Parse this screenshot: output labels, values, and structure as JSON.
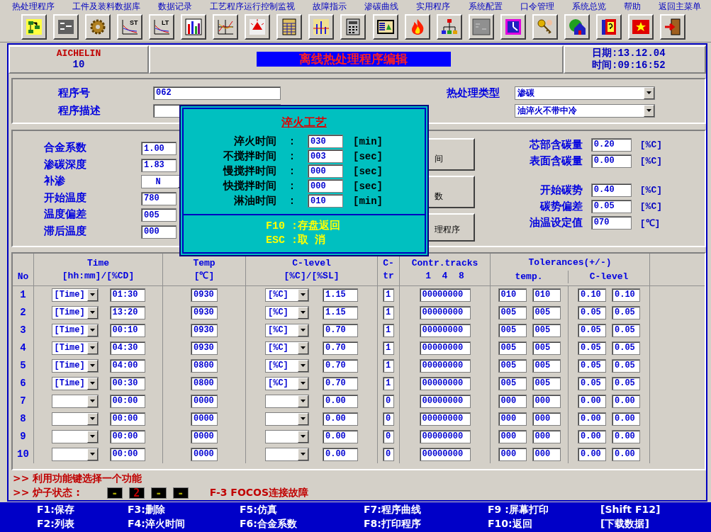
{
  "menu": [
    "热处理程序",
    "工件及装料数据库",
    "数据记录",
    "工艺程序运行控制监视",
    "故障指示",
    "渗碳曲线",
    "实用程序",
    "系统配置",
    "口令管理",
    "系统总览",
    "帮助",
    "返回主菜单"
  ],
  "toolbar": [
    {
      "kind": "flowchart"
    },
    {
      "kind": "list"
    },
    {
      "kind": "gear"
    },
    {
      "kind": "trend",
      "text": "ST"
    },
    {
      "kind": "trend",
      "text": "LT"
    },
    {
      "kind": "bars"
    },
    {
      "kind": "lines"
    },
    {
      "kind": "alarm"
    },
    {
      "kind": "grid"
    },
    {
      "kind": "gauge"
    },
    {
      "kind": "calculator"
    },
    {
      "kind": "monitor"
    },
    {
      "kind": "fire"
    },
    {
      "kind": "network"
    },
    {
      "kind": "panel"
    },
    {
      "kind": "clock"
    },
    {
      "kind": "keys"
    },
    {
      "kind": "house"
    },
    {
      "kind": "help"
    },
    {
      "kind": "flag"
    },
    {
      "kind": "exit"
    }
  ],
  "header": {
    "brand": "AICHELIN",
    "unit": "10",
    "title": "离线热处理程序编辑",
    "date": "日期:13.12.04",
    "time": "时间:09:16:52"
  },
  "program": {
    "number_label": "程序号",
    "number": "062",
    "desc_label": "程序描述",
    "type_label": "热处理类型",
    "type": "渗碳",
    "subtype": "油淬火不带中冷"
  },
  "params_left": [
    {
      "kind": "field",
      "label": "合金系数",
      "value": "1.00"
    },
    {
      "kind": "field",
      "label": "渗碳深度",
      "value": "1.83"
    },
    {
      "kind": "dropdown",
      "label": "补渗",
      "value": "N"
    },
    {
      "kind": "field",
      "label": "开始温度",
      "value": "780"
    },
    {
      "kind": "field",
      "label": "温度偏差",
      "value": "005"
    },
    {
      "kind": "field",
      "label": "滞后温度",
      "value": "000"
    }
  ],
  "side_buttons": [
    "间",
    "数",
    "理程序"
  ],
  "carbon": [
    {
      "label": "芯部含碳量",
      "value": "0.20",
      "unit": "[%C]"
    },
    {
      "label": "表面含碳量",
      "value": "0.00",
      "unit": "[%C]"
    }
  ],
  "atmosphere": [
    {
      "label": "开始碳势",
      "value": "0.40",
      "unit": "[%C]"
    },
    {
      "label": "碳势偏差",
      "value": "0.05",
      "unit": "[%C]"
    },
    {
      "label": "油温设定值",
      "value": "070",
      "unit": "[℃]"
    }
  ],
  "table": {
    "columns": {
      "no": "No",
      "time": [
        "Time",
        "[hh:mm]/[%CD]"
      ],
      "temp": [
        "Temp",
        "[℃]"
      ],
      "c_level": [
        "C-level",
        "[%C]/[%SL]"
      ],
      "ctr": [
        "C-",
        "tr"
      ],
      "tracks": [
        "Contr.tracks",
        "1  4  8"
      ],
      "tolerances": "Tolerances(+/-)",
      "tol_temp": "temp.",
      "tol_c": "C-level"
    },
    "rows": [
      {
        "no": "1",
        "mode": "[Time]",
        "time": "01:30",
        "temp": "0930",
        "c_mode": "[%C]",
        "c_level": "1.15",
        "ctr": "1",
        "tracks": "00000000",
        "tol_temp": [
          "010",
          "010"
        ],
        "tol_c": [
          "0.10",
          "0.10"
        ]
      },
      {
        "no": "2",
        "mode": "[Time]",
        "time": "13:20",
        "temp": "0930",
        "c_mode": "[%C]",
        "c_level": "1.15",
        "ctr": "1",
        "tracks": "00000000",
        "tol_temp": [
          "005",
          "005"
        ],
        "tol_c": [
          "0.05",
          "0.05"
        ]
      },
      {
        "no": "3",
        "mode": "[Time]",
        "time": "00:10",
        "temp": "0930",
        "c_mode": "[%C]",
        "c_level": "0.70",
        "ctr": "1",
        "tracks": "00000000",
        "tol_temp": [
          "005",
          "005"
        ],
        "tol_c": [
          "0.05",
          "0.05"
        ]
      },
      {
        "no": "4",
        "mode": "[Time]",
        "time": "04:30",
        "temp": "0930",
        "c_mode": "[%C]",
        "c_level": "0.70",
        "ctr": "1",
        "tracks": "00000000",
        "tol_temp": [
          "005",
          "005"
        ],
        "tol_c": [
          "0.05",
          "0.05"
        ]
      },
      {
        "no": "5",
        "mode": "[Time]",
        "time": "04:00",
        "temp": "0800",
        "c_mode": "[%C]",
        "c_level": "0.70",
        "ctr": "1",
        "tracks": "00000000",
        "tol_temp": [
          "005",
          "005"
        ],
        "tol_c": [
          "0.05",
          "0.05"
        ]
      },
      {
        "no": "6",
        "mode": "[Time]",
        "time": "00:30",
        "temp": "0800",
        "c_mode": "[%C]",
        "c_level": "0.70",
        "ctr": "1",
        "tracks": "00000000",
        "tol_temp": [
          "005",
          "005"
        ],
        "tol_c": [
          "0.05",
          "0.05"
        ]
      },
      {
        "no": "7",
        "time": "00:00",
        "temp": "0000",
        "c_level": "0.00",
        "ctr": "0",
        "tracks": "00000000",
        "tol_temp": [
          "000",
          "000"
        ],
        "tol_c": [
          "0.00",
          "0.00"
        ]
      },
      {
        "no": "8",
        "time": "00:00",
        "temp": "0000",
        "c_level": "0.00",
        "ctr": "0",
        "tracks": "00000000",
        "tol_temp": [
          "000",
          "000"
        ],
        "tol_c": [
          "0.00",
          "0.00"
        ]
      },
      {
        "no": "9",
        "time": "00:00",
        "temp": "0000",
        "c_level": "0.00",
        "ctr": "0",
        "tracks": "00000000",
        "tol_temp": [
          "000",
          "000"
        ],
        "tol_c": [
          "0.00",
          "0.00"
        ]
      },
      {
        "no": "10",
        "time": "00:00",
        "temp": "0000",
        "c_level": "0.00",
        "ctr": "0",
        "tracks": "00000000",
        "tol_temp": [
          "000",
          "000"
        ],
        "tol_c": [
          "0.00",
          "0.00"
        ]
      }
    ]
  },
  "status": {
    "message": ">> 利用功能键选择一个功能",
    "furnace_label": ">> 炉子状态 :",
    "indicators": [
      {
        "kind": "idle",
        "text": "-"
      },
      {
        "kind": "active",
        "text": "2"
      },
      {
        "kind": "idle",
        "text": "-"
      },
      {
        "kind": "idle",
        "text": "-"
      }
    ],
    "fault": "F-3 FOCOS连接故障"
  },
  "function_keys": [
    [
      "F1:保存",
      "F3:删除",
      "F5:仿真",
      "F7:程序曲线",
      "F9 :屏幕打印",
      "[Shift F12]"
    ],
    [
      "F2:列表",
      "F4:淬火时间",
      "F6:合金系数",
      "F8:打印程序",
      "F10:返回",
      "[下载数据]"
    ]
  ],
  "popup": {
    "title": "淬火工艺",
    "rows": [
      {
        "label": "淬火时间",
        "sep": ":",
        "value": "030",
        "unit": "[min]"
      },
      {
        "label": "不搅拌时间",
        "sep": ":",
        "value": "003",
        "unit": "[sec]"
      },
      {
        "label": "慢搅拌时间",
        "sep": ":",
        "value": "000",
        "unit": "[sec]"
      },
      {
        "label": "快搅拌时间",
        "sep": ":",
        "value": "000",
        "unit": "[sec]"
      },
      {
        "label": "淋油时间",
        "sep": ":",
        "value": "010",
        "unit": "[min]"
      }
    ],
    "hints": [
      "F10 :存盘返回",
      "ESC :取 消"
    ]
  }
}
